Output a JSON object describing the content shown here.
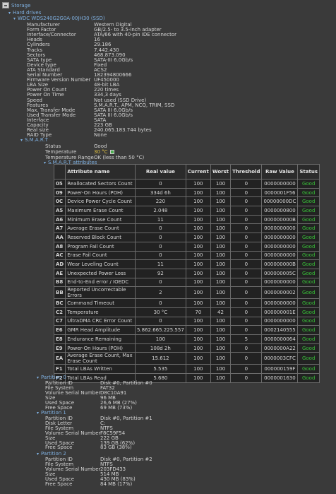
{
  "tree": {
    "storage": "Storage",
    "hard_drives": "Hard drives",
    "drive": "WDC WDS240G2G0A-00JH30 (SSD)",
    "smart": "S.M.A.R.T",
    "smart_attributes": "S.M.A.R.T attributes"
  },
  "drive_props": [
    {
      "k": "Manufacturer",
      "v": "Western Digital"
    },
    {
      "k": "Form Factor",
      "v": "GB/2.5- to 3.5-inch adapter"
    },
    {
      "k": "Interface/Connector",
      "v": "ATA/66 with 40-pin IDE connector"
    },
    {
      "k": "Heads",
      "v": "16"
    },
    {
      "k": "Cylinders",
      "v": "29.186"
    },
    {
      "k": "Tracks",
      "v": "7.442.430"
    },
    {
      "k": "Sectors",
      "v": "468.873.090"
    },
    {
      "k": "SATA type",
      "v": "SATA-III 6.0Gb/s"
    },
    {
      "k": "Device type",
      "v": "Fixed"
    },
    {
      "k": "ATA Standard",
      "v": "ACS2"
    },
    {
      "k": "Serial Number",
      "v": "182394800666"
    },
    {
      "k": "Firmware Version Number",
      "v": "UF450000"
    },
    {
      "k": "LBA Size",
      "v": "48-bit LBA"
    },
    {
      "k": "Power On Count",
      "v": "220 times"
    },
    {
      "k": "Power On Time",
      "v": "334,3 days"
    },
    {
      "k": "Speed",
      "v": "Not used (SSD Drive)"
    },
    {
      "k": "Features",
      "v": "S.M.A.R.T., APM, NCQ, TRIM, SSD"
    },
    {
      "k": "Max. Transfer Mode",
      "v": "SATA III 6.0Gb/s"
    },
    {
      "k": "Used Transfer Mode",
      "v": "SATA III 6.0Gb/s"
    },
    {
      "k": "Interface",
      "v": "SATA"
    },
    {
      "k": "Capacity",
      "v": "223 GB"
    },
    {
      "k": "Real size",
      "v": "240.065.183.744 bytes"
    },
    {
      "k": "RAID Type",
      "v": "None"
    }
  ],
  "smart_props": {
    "status_k": "Status",
    "status_v": "Good",
    "temp_k": "Temperature",
    "temp_v": "30 °C",
    "range_k": "Temperature Range",
    "range_v": "OK (less than 50 °C)"
  },
  "table": {
    "headers": [
      "",
      "Attribute name",
      "Real value",
      "Current",
      "Worst",
      "Threshold",
      "Raw Value",
      "Status"
    ],
    "rows": [
      [
        "05",
        "Reallocated Sectors Count",
        "0",
        "100",
        "100",
        "0",
        "0000000000",
        "Good"
      ],
      [
        "09",
        "Power-On Hours (POH)",
        "334d 6h",
        "100",
        "100",
        "0",
        "0000001F56",
        "Good"
      ],
      [
        "0C",
        "Device Power Cycle Count",
        "220",
        "100",
        "100",
        "0",
        "00000000DC",
        "Good"
      ],
      [
        "A5",
        "Maximum Erase Count",
        "2.048",
        "100",
        "100",
        "0",
        "0000000800",
        "Good"
      ],
      [
        "A6",
        "Minimum Erase Count",
        "11",
        "100",
        "100",
        "0",
        "000000000B",
        "Good"
      ],
      [
        "A7",
        "Average Erase Count",
        "0",
        "100",
        "100",
        "0",
        "0000000000",
        "Good"
      ],
      [
        "AA",
        "Reserved Block Count",
        "0",
        "100",
        "100",
        "0",
        "0000000000",
        "Good"
      ],
      [
        "A8",
        "Program Fail Count",
        "0",
        "100",
        "100",
        "0",
        "0000000000",
        "Good"
      ],
      [
        "AC",
        "Erase Fail Count",
        "0",
        "100",
        "100",
        "0",
        "0000000000",
        "Good"
      ],
      [
        "AD",
        "Wear Leveling Count",
        "11",
        "100",
        "100",
        "0",
        "000000000B",
        "Good"
      ],
      [
        "AE",
        "Unexpected Power Loss",
        "92",
        "100",
        "100",
        "0",
        "000000005C",
        "Good"
      ],
      [
        "B8",
        "End-to-End error / IOEDC",
        "0",
        "100",
        "100",
        "0",
        "0000000000",
        "Good"
      ],
      [
        "BB",
        "Reported Uncorrectable Errors",
        "2",
        "100",
        "100",
        "0",
        "0000000002",
        "Good"
      ],
      [
        "BC",
        "Command Timeout",
        "0",
        "100",
        "100",
        "0",
        "0000000000",
        "Good"
      ],
      [
        "C2",
        "Temperature",
        "30 °C",
        "70",
        "42",
        "0",
        "000000001E",
        "Good"
      ],
      [
        "C7",
        "UltraDMA CRC Error Count",
        "0",
        "100",
        "100",
        "0",
        "0000000000",
        "Good"
      ],
      [
        "E6",
        "GMR Head Amplitude",
        "5.862.665.225.557",
        "100",
        "100",
        "0",
        "0002140555",
        "Good"
      ],
      [
        "E8",
        "Endurance Remaining",
        "100",
        "100",
        "100",
        "5",
        "0000000064",
        "Good"
      ],
      [
        "E9",
        "Power-On Hours (POH)",
        "108d 2h",
        "100",
        "100",
        "0",
        "0000000A22",
        "Good"
      ],
      [
        "EA",
        "Average Erase Count, Max Erase Count",
        "15.612",
        "100",
        "100",
        "0",
        "0000003CFC",
        "Good"
      ],
      [
        "F1",
        "Total LBAs Written",
        "5.535",
        "100",
        "100",
        "0",
        "000000159F",
        "Good"
      ],
      [
        "F2",
        "Total LBAs Read",
        "5.680",
        "100",
        "100",
        "0",
        "0000001630",
        "Good"
      ]
    ]
  },
  "partitions": [
    {
      "title": "Partition 0",
      "props": [
        {
          "k": "Partition ID",
          "v": "Disk #0, Partition #0"
        },
        {
          "k": "File System",
          "v": "FAT32"
        },
        {
          "k": "Volume Serial Number",
          "v": "D8C10A91"
        },
        {
          "k": "Size",
          "v": "96 MB"
        },
        {
          "k": "Used Space",
          "v": "26,6 MB (27%)"
        },
        {
          "k": "Free Space",
          "v": "69 MB (73%)"
        }
      ]
    },
    {
      "title": "Partition 1",
      "props": [
        {
          "k": "Partition ID",
          "v": "Disk #0, Partition #1"
        },
        {
          "k": "Disk Letter",
          "v": "C:"
        },
        {
          "k": "File System",
          "v": "NTFS"
        },
        {
          "k": "Volume Serial Number",
          "v": "F8C59F54"
        },
        {
          "k": "Size",
          "v": "222 GB"
        },
        {
          "k": "Used Space",
          "v": "139 GB (62%)"
        },
        {
          "k": "Free Space",
          "v": "83 GB (38%)"
        }
      ]
    },
    {
      "title": "Partition 2",
      "props": [
        {
          "k": "Partition ID",
          "v": "Disk #0, Partition #2"
        },
        {
          "k": "File System",
          "v": "NTFS"
        },
        {
          "k": "Volume Serial Number",
          "v": "203FD433"
        },
        {
          "k": "Size",
          "v": "514 MB"
        },
        {
          "k": "Used Space",
          "v": "430 MB (83%)"
        },
        {
          "k": "Free Space",
          "v": "84 MB (17%)"
        }
      ]
    }
  ]
}
